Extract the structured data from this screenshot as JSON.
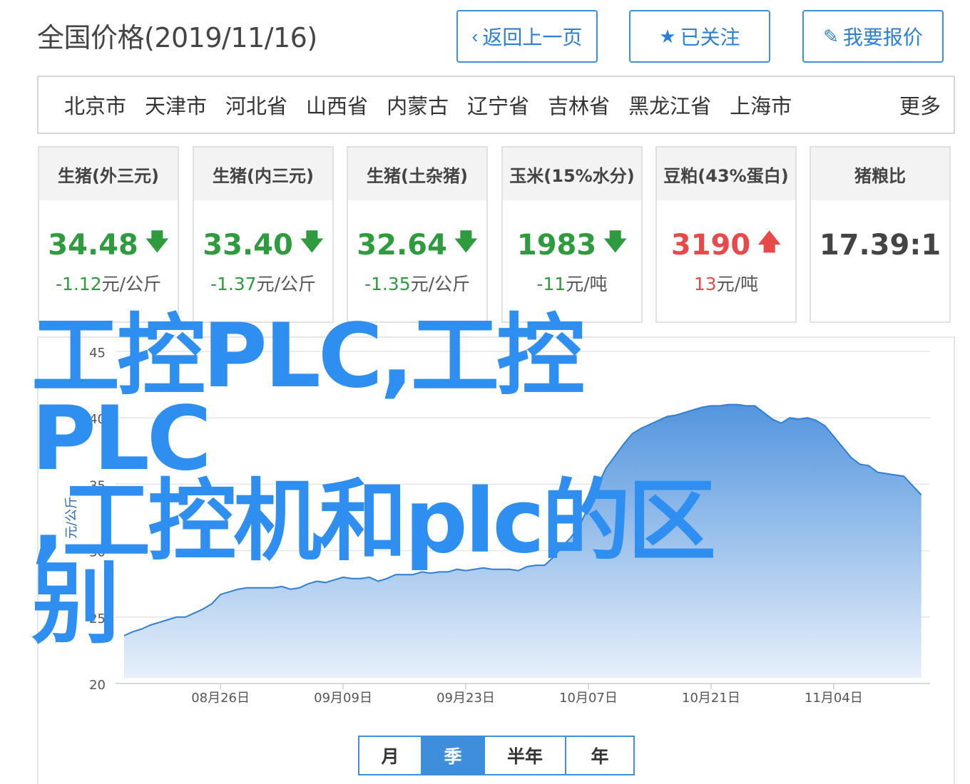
{
  "header": {
    "title": "全国价格(2019/11/16)",
    "back_label": "返回上一页",
    "follow_label": "已关注",
    "quote_label": "我要报价"
  },
  "regions": {
    "items": [
      "北京市",
      "天津市",
      "河北省",
      "山西省",
      "内蒙古",
      "辽宁省",
      "吉林省",
      "黑龙江省",
      "上海市"
    ],
    "more": "更多"
  },
  "cards": [
    {
      "title": "生猪(外三元)",
      "value": "34.48",
      "trend": "down",
      "change_num": "-1.12",
      "change_unit": "元/公斤"
    },
    {
      "title": "生猪(内三元)",
      "value": "33.40",
      "trend": "down",
      "change_num": "-1.37",
      "change_unit": "元/公斤"
    },
    {
      "title": "生猪(土杂猪)",
      "value": "32.64",
      "trend": "down",
      "change_num": "-1.35",
      "change_unit": "元/公斤"
    },
    {
      "title": "玉米(15%水分)",
      "value": "1983",
      "trend": "down",
      "change_num": "-11",
      "change_unit": "元/吨"
    },
    {
      "title": "豆粕(43%蛋白)",
      "value": "3190",
      "trend": "up",
      "change_num": "13",
      "change_unit": "元/吨"
    },
    {
      "title": "猪粮比",
      "value": "17.39:1",
      "trend": "none",
      "change_num": "",
      "change_unit": ""
    }
  ],
  "colors": {
    "accent": "#3f8edc",
    "down": "#2f9b3f",
    "up": "#e84a4a",
    "area_top": "#4a8fdc",
    "area_bottom": "#e6effa"
  },
  "icons": {
    "back": "chevron-left-icon",
    "follow": "star-icon",
    "quote": "edit-icon",
    "down": "arrow-down-icon",
    "up": "arrow-up-icon"
  },
  "chart_data": {
    "type": "area",
    "ylabel": "元/公斤",
    "ylim": [
      20,
      45
    ],
    "yticks": [
      20,
      25,
      30,
      35,
      40,
      45
    ],
    "xtick_labels": [
      "08月26日",
      "09月09日",
      "09月23日",
      "10月07日",
      "10月21日",
      "11月04日"
    ],
    "xtick_days": [
      11,
      25,
      39,
      53,
      67,
      81
    ],
    "x_day_range": [
      0,
      92
    ],
    "grid": true,
    "series": [
      {
        "days": [
          0,
          1,
          2,
          3,
          4,
          5,
          6,
          7,
          8,
          9,
          10,
          11,
          12,
          13,
          14,
          15,
          16,
          17,
          18,
          19,
          20,
          21,
          22,
          23,
          24,
          25,
          26,
          27,
          28,
          29,
          30,
          31,
          32,
          33,
          34,
          35,
          36,
          37,
          38,
          39,
          40,
          41,
          42,
          43,
          44,
          45,
          46,
          47,
          48,
          49,
          50,
          51,
          52,
          53,
          54,
          55,
          56,
          57,
          58,
          59,
          60,
          61,
          62,
          63,
          64,
          65,
          66,
          67,
          68,
          69,
          70,
          71,
          72,
          73,
          74,
          75,
          76,
          77,
          78,
          79,
          80,
          81,
          82,
          83,
          84,
          85,
          86,
          87,
          88,
          89,
          90,
          91
        ],
        "values": [
          23.6,
          23.9,
          24.1,
          24.4,
          24.6,
          24.8,
          25.0,
          25.0,
          25.3,
          25.6,
          26.0,
          26.7,
          26.9,
          27.1,
          27.2,
          27.2,
          27.2,
          27.2,
          27.3,
          27.1,
          27.2,
          27.5,
          27.7,
          27.6,
          27.8,
          28.0,
          27.9,
          27.9,
          28.0,
          27.7,
          27.9,
          28.2,
          28.2,
          28.2,
          28.4,
          28.3,
          28.4,
          28.4,
          28.6,
          28.5,
          28.6,
          28.7,
          28.6,
          28.6,
          28.6,
          28.5,
          28.8,
          28.9,
          28.9,
          29.5,
          30.3,
          31.0,
          31.9,
          33.3,
          34.8,
          36.2,
          37.1,
          38.0,
          38.8,
          39.2,
          39.5,
          39.8,
          40.1,
          40.2,
          40.4,
          40.6,
          40.8,
          40.9,
          40.9,
          41.0,
          41.0,
          40.9,
          40.9,
          40.4,
          39.9,
          39.6,
          40.0,
          39.9,
          40.0,
          39.8,
          39.4,
          38.6,
          37.8,
          37.0,
          36.5,
          36.4,
          35.9,
          35.8,
          35.7,
          35.6,
          34.9,
          34.2
        ]
      }
    ]
  },
  "periods": {
    "items": [
      "月",
      "季",
      "半年",
      "年"
    ],
    "active": 1
  },
  "watermark": {
    "line1": "工控PLC,工控PLC",
    "line2": ",工控机和plc的区别"
  }
}
